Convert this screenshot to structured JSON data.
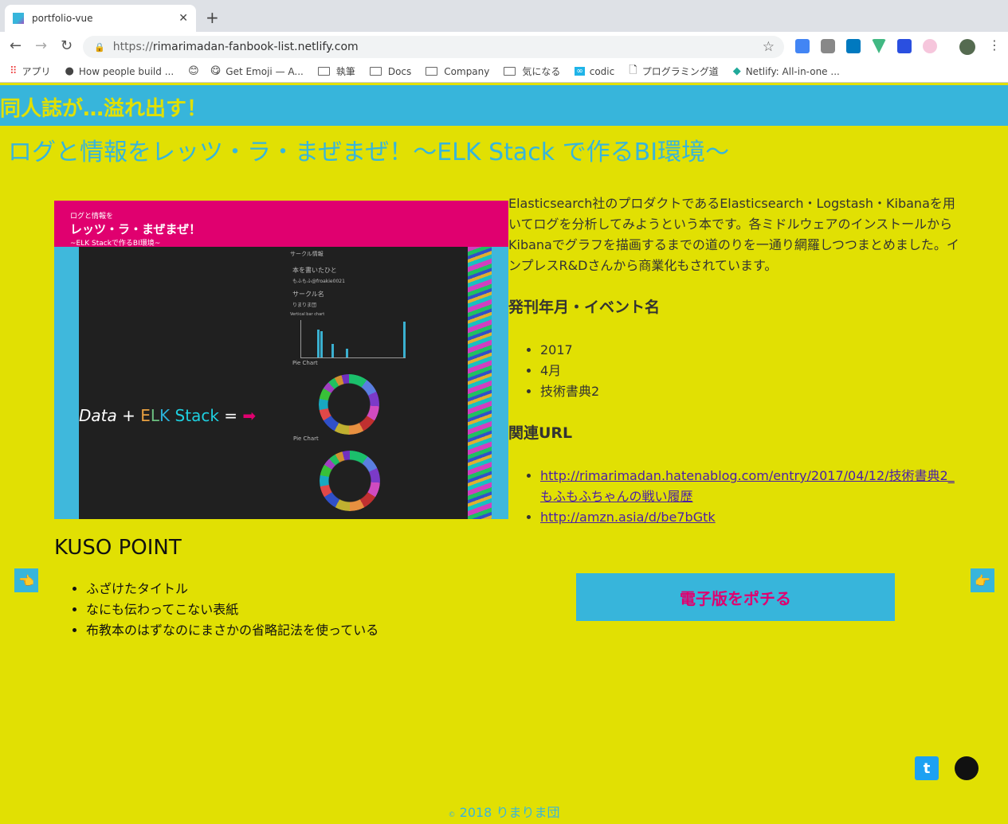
{
  "browser": {
    "tab_title": "portfolio-vue",
    "url_scheme": "https://",
    "url_host": "rimarimadan-fanbook-list.netlify.com",
    "bookmarks": [
      {
        "label": "アプリ",
        "icon": "apps-grid-icon"
      },
      {
        "label": "How people build ...",
        "icon": "github-icon"
      },
      {
        "label": "",
        "icon": "emoji-face-icon"
      },
      {
        "label": "Get Emoji — A...",
        "icon": "emoji-tongue-icon"
      },
      {
        "label": "執筆",
        "icon": "folder-icon"
      },
      {
        "label": "Docs",
        "icon": "folder-icon"
      },
      {
        "label": "Company",
        "icon": "folder-icon"
      },
      {
        "label": "気になる",
        "icon": "folder-icon"
      },
      {
        "label": "codic",
        "icon": "codic-icon"
      },
      {
        "label": "プログラミング道",
        "icon": "page-icon"
      },
      {
        "label": "Netlify: All-in-one ...",
        "icon": "netlify-icon"
      }
    ]
  },
  "header": {
    "site_title": "同人誌が…溢れ出す！"
  },
  "book": {
    "title": "ログと情報をレッツ・ラ・まぜまぜ！〜ELK Stack で作るBI環境〜",
    "cover": {
      "line1": "ログと情報を",
      "line2": "レッツ・ラ・まぜまぜ！",
      "line3": "~ELK Stackで作るBI環境~",
      "formula_data": "Data",
      "formula_plus": "+",
      "formula_e": "E",
      "formula_l": "L",
      "formula_k": "K",
      "formula_stack": "Stack",
      "formula_eq": "=",
      "circle_info": "サークル情報",
      "author_label": "本を書いたひと",
      "author": "もふもふ@froakie0021",
      "circle_label": "サークル名",
      "circle": "りまりま団",
      "bar_chart_label": "Vertical bar chart",
      "pie_label": "Pie Chart"
    },
    "description": "Elasticsearch社のプロダクトであるElasticsearch・Logstash・Kibanaを用いてログを分析してみようという本です。各ミドルウェアのインストールからKibanaでグラフを描画するまでの道のりを一通り網羅しつつまとめました。インプレスR&Dさんから商業化もされています。",
    "release_heading": "発刊年月・イベント名",
    "release": [
      "2017",
      "4月",
      "技術書典2"
    ],
    "url_heading": "関連URL",
    "urls": [
      "http://rimarimadan.hatenablog.com/entry/2017/04/12/技術書典2_もふもふちゃんの戦い履歴",
      "http://amzn.asia/d/be7bGtk"
    ],
    "kuso_heading": "KUSO POINT",
    "kuso_points": [
      "ふざけたタイトル",
      "なにも伝わってこない表紙",
      "布教本のはずなのにまさかの省略記法を使っている"
    ],
    "buy_label": "電子版をポチる"
  },
  "nav": {
    "prev_icon": "👈",
    "next_icon": "👉"
  },
  "footer": {
    "copyright_symbol": "©",
    "text": "2018 りまりま団"
  },
  "colors": {
    "background": "#e1e003",
    "accent_blue": "#37b5db",
    "accent_magenta": "#e0006f"
  }
}
